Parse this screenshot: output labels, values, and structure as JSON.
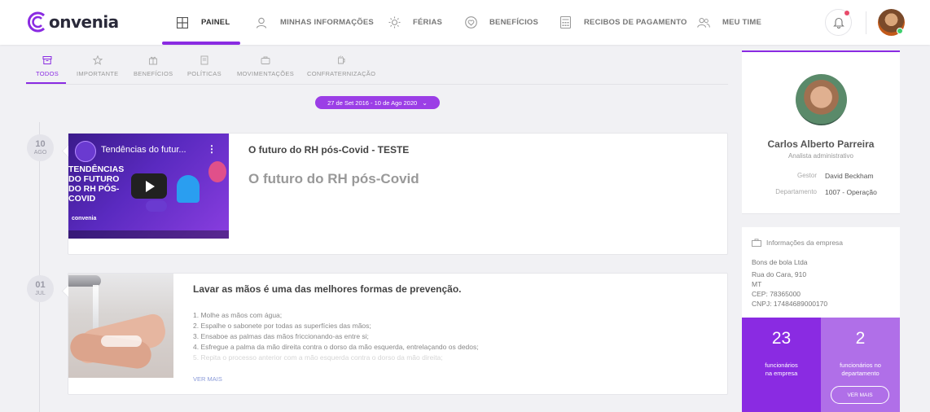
{
  "brand": {
    "name": "onvenia",
    "accent": "#8a2be2"
  },
  "nav": {
    "items": [
      {
        "label": "PAINEL",
        "icon": "grid-icon"
      },
      {
        "label": "MINHAS INFORMAÇÕES",
        "icon": "user-icon"
      },
      {
        "label": "FÉRIAS",
        "icon": "sun-icon"
      },
      {
        "label": "BENEFÍCIOS",
        "icon": "heart-icon"
      },
      {
        "label": "RECIBOS DE PAGAMENTO",
        "icon": "calculator-icon"
      },
      {
        "label": "MEU TIME",
        "icon": "team-icon"
      }
    ],
    "active": "PAINEL"
  },
  "filters": {
    "tabs": [
      "TODOS",
      "IMPORTANTE",
      "BENEFÍCIOS",
      "POLÍTICAS",
      "MOVIMENTAÇÕES",
      "CONFRATERNIZAÇÃO"
    ],
    "active": "TODOS",
    "date_range": "27 de Set 2016 - 10 de Ago 2020"
  },
  "feed": [
    {
      "day": "10",
      "month": "AGO",
      "title": "O futuro do RH pós-Covid - TESTE",
      "subtitle": "O futuro do RH pós-Covid",
      "video": {
        "title": "Tendências do futur...",
        "headline": "TENDÊNCIAS DO FUTURO DO RH PÓS-COVID",
        "brand": "convenia"
      }
    },
    {
      "day": "01",
      "month": "JUL",
      "title": "Lavar as mãos é uma das melhores formas de prevenção.",
      "steps": [
        "1. Molhe as mãos com água;",
        "2. Espalhe o sabonete por todas as superfícies das mãos;",
        "3. Ensaboe as palmas das mãos friccionando-as entre si;",
        "4. Esfregue a palma da mão direita contra o dorso da mão esquerda, entrelaçando os dedos;",
        "5. Repita o processo anterior com a mão esquerda contra o dorso da mão direita;"
      ],
      "link": "VER MAIS"
    }
  ],
  "profile": {
    "name": "Carlos Alberto Parreira",
    "role": "Analista administrativo",
    "manager_label": "Gestor",
    "manager": "David Beckham",
    "department_label": "Departamento",
    "department": "1007 - Operação"
  },
  "company": {
    "title": "Informações da empresa",
    "name": "Bons de bola Ltda",
    "address": "Rua do Cara, 910",
    "state": "MT",
    "cep": "CEP: 78365000",
    "cnpj": "CNPJ: 17484689000170"
  },
  "stats": [
    {
      "value": "23",
      "label1": "funcionários",
      "label2": "na empresa",
      "color": "#8a2be2"
    },
    {
      "value": "2",
      "label1": "funcionários no",
      "label2": "departamento",
      "color": "#b06fe8",
      "button": "VER MAIS"
    }
  ]
}
